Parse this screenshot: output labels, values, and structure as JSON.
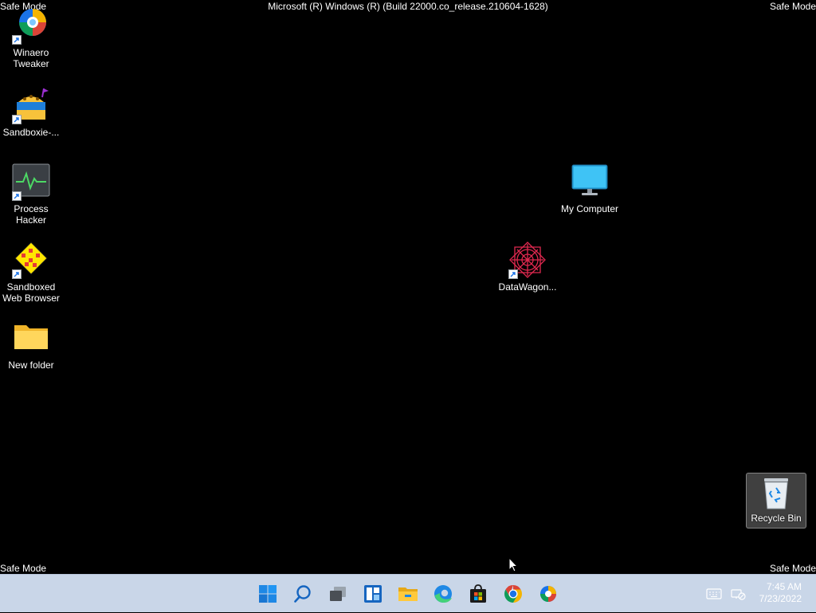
{
  "os_overlay": {
    "safe_mode_label": "Safe Mode",
    "build_title": "Microsoft (R) Windows (R) (Build 22000.co_release.210604-1628)"
  },
  "desktop_icons": {
    "winaero_tweaker": {
      "label": "Winaero Tweaker",
      "icon": "winaero-tweaker-icon"
    },
    "sandboxie": {
      "label": "Sandboxie-...",
      "icon": "sandboxie-icon"
    },
    "process_hacker": {
      "label": "Process Hacker",
      "icon": "process-hacker-icon"
    },
    "sandboxed_web_browser": {
      "label": "Sandboxed Web Browser",
      "icon": "sandboxed-browser-icon"
    },
    "new_folder": {
      "label": "New folder",
      "icon": "folder-icon"
    },
    "my_computer": {
      "label": "My Computer",
      "icon": "monitor-icon"
    },
    "datawagon": {
      "label": "DataWagon...",
      "icon": "datawagon-icon"
    },
    "recycle_bin": {
      "label": "Recycle Bin",
      "icon": "recycle-bin-icon"
    }
  },
  "taskbar": {
    "background_color": "#c9d6e8",
    "pinned": [
      {
        "name": "start",
        "icon": "windows-start-icon"
      },
      {
        "name": "search",
        "icon": "search-icon"
      },
      {
        "name": "task-view",
        "icon": "task-view-icon"
      },
      {
        "name": "widgets",
        "icon": "widgets-icon"
      },
      {
        "name": "file-explorer",
        "icon": "file-explorer-icon"
      },
      {
        "name": "edge",
        "icon": "edge-icon"
      },
      {
        "name": "store",
        "icon": "store-icon"
      },
      {
        "name": "chrome",
        "icon": "chrome-icon"
      },
      {
        "name": "winaero",
        "icon": "winaero-taskbar-icon"
      }
    ],
    "tray": {
      "keyboard_icon": "keyboard-icon",
      "network_icon": "network-off-icon",
      "time": "7:45 AM",
      "date": "7/23/2022"
    }
  }
}
